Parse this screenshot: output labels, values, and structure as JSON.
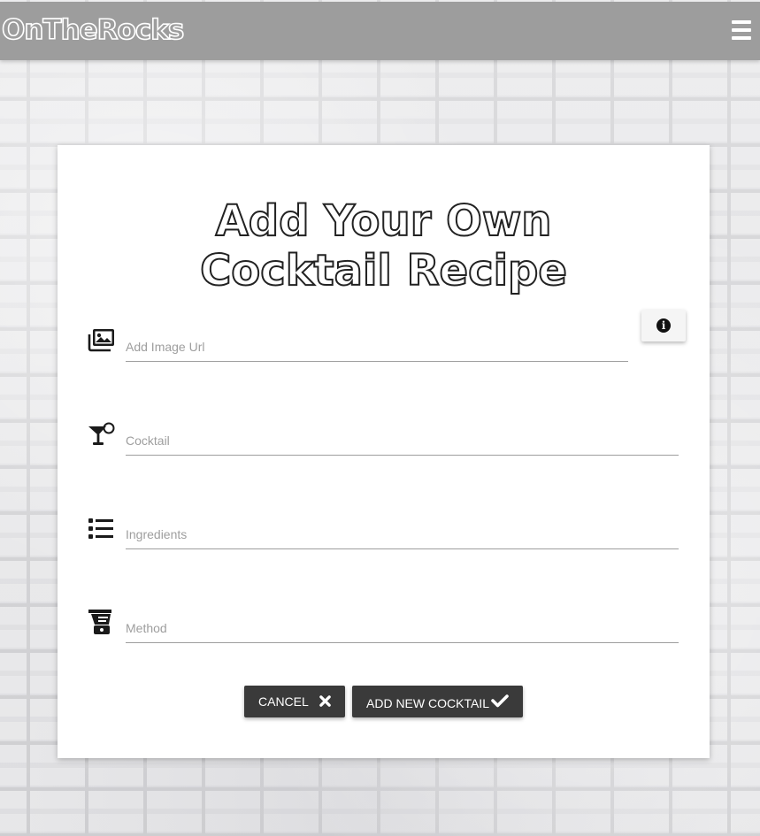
{
  "app": {
    "brand": "OnTheRocks",
    "menu_icon": "hamburger-menu-icon"
  },
  "page": {
    "title_line1": "Add Your Own",
    "title_line2": "Cocktail Recipe"
  },
  "form": {
    "info_icon": "info-circle-icon",
    "fields": [
      {
        "icon": "images-icon",
        "placeholder": "Add Image Url",
        "value": ""
      },
      {
        "icon": "cocktail-glass-icon",
        "placeholder": "Cocktail",
        "value": ""
      },
      {
        "icon": "list-icon",
        "placeholder": "Ingredients",
        "value": ""
      },
      {
        "icon": "blender-icon",
        "placeholder": "Method",
        "value": ""
      }
    ],
    "cancel_label": "Cancel",
    "cancel_icon": "close-x-icon",
    "submit_label": "Add New Cocktail",
    "submit_icon": "checkmark-icon"
  },
  "colors": {
    "navbar": "#9d9d9d",
    "button": "#3a3a3a",
    "card": "#ffffff"
  }
}
